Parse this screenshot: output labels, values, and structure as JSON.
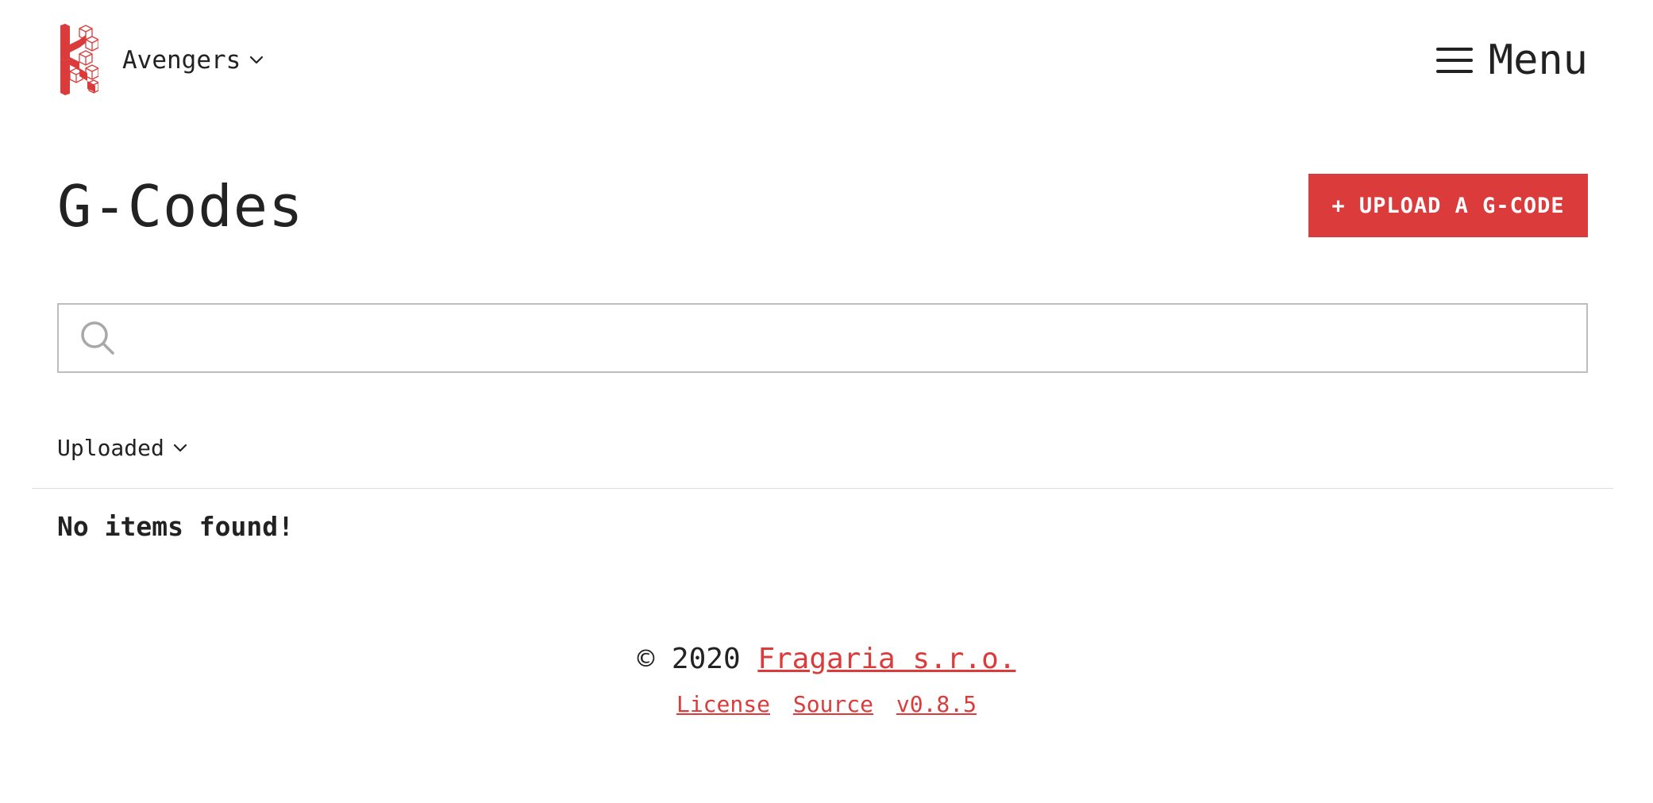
{
  "header": {
    "team_name": "Avengers",
    "menu_label": "Menu",
    "icons": {
      "logo": "kamino-logo",
      "team_chevron": "chevron-down-icon",
      "menu": "hamburger-menu-icon"
    }
  },
  "main": {
    "title": "G-Codes",
    "upload_button_label": "+ UPLOAD A G-CODE",
    "search": {
      "value": "",
      "placeholder": "",
      "icon": "search-icon"
    },
    "sort": {
      "label": "Uploaded",
      "icon": "chevron-down-icon"
    },
    "empty_message": "No items found!"
  },
  "footer": {
    "copyright_prefix": "© 2020",
    "company_link": "Fragaria s.r.o.",
    "links": [
      "License",
      "Source",
      "v0.8.5"
    ]
  },
  "colors": {
    "accent": "#db3b3b",
    "text": "#222222",
    "border": "#bdbdbd",
    "divider": "#dddddd"
  }
}
